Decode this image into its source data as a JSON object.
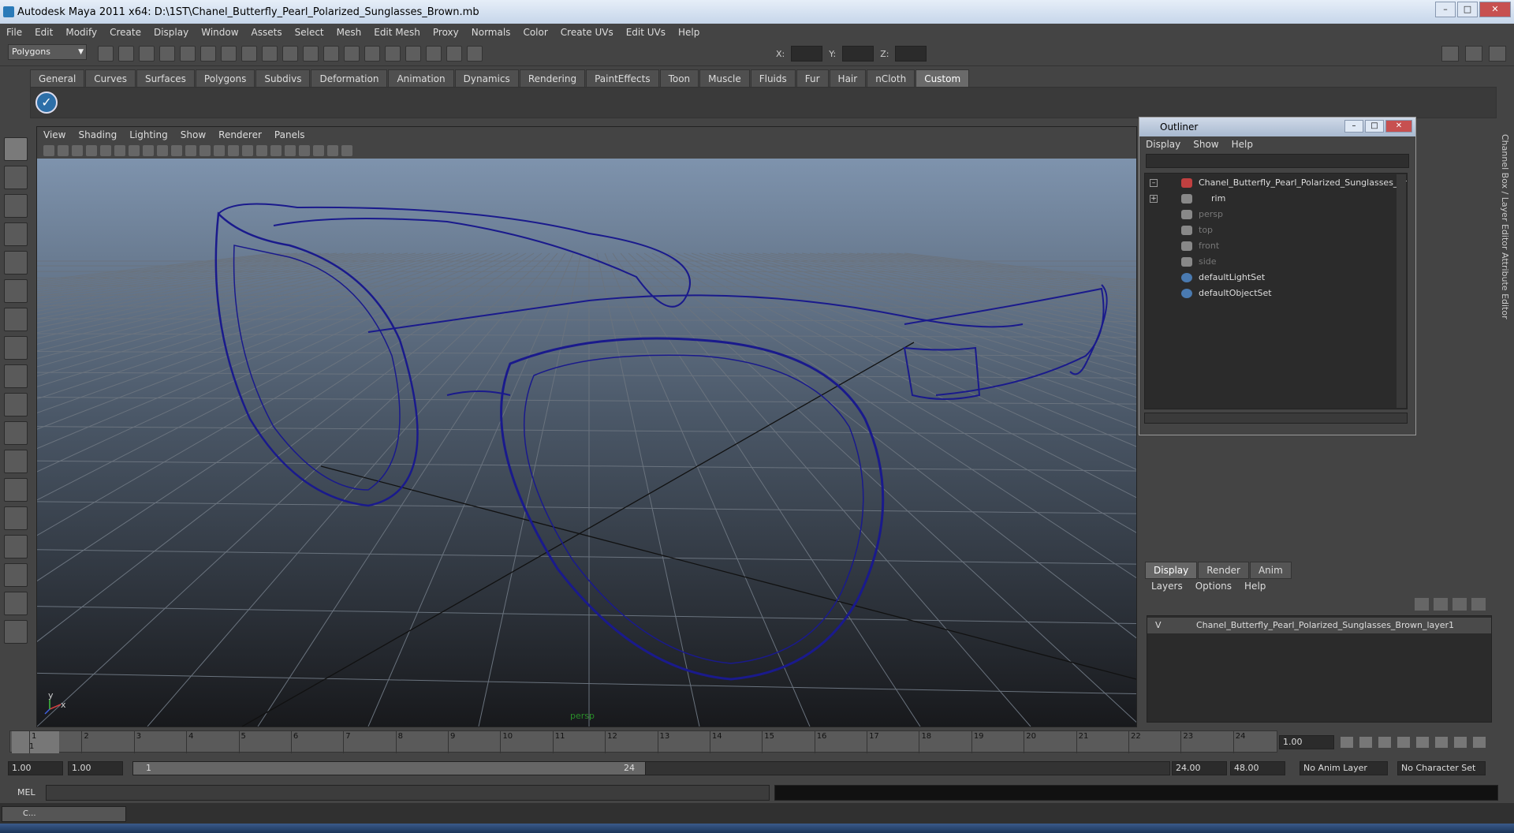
{
  "window": {
    "title": "Autodesk Maya 2011 x64: D:\\1ST\\Chanel_Butterfly_Pearl_Polarized_Sunglasses_Brown.mb"
  },
  "menus": [
    "File",
    "Edit",
    "Modify",
    "Create",
    "Display",
    "Window",
    "Assets",
    "Select",
    "Mesh",
    "Edit Mesh",
    "Proxy",
    "Normals",
    "Color",
    "Create UVs",
    "Edit UVs",
    "Help"
  ],
  "toolbar": {
    "mode": "Polygons",
    "x_label": "X:",
    "y_label": "Y:",
    "z_label": "Z:"
  },
  "shelf_tabs": [
    "General",
    "Curves",
    "Surfaces",
    "Polygons",
    "Subdivs",
    "Deformation",
    "Animation",
    "Dynamics",
    "Rendering",
    "PaintEffects",
    "Toon",
    "Muscle",
    "Fluids",
    "Fur",
    "Hair",
    "nCloth",
    "Custom"
  ],
  "viewport": {
    "menus": [
      "View",
      "Shading",
      "Lighting",
      "Show",
      "Renderer",
      "Panels"
    ],
    "camera_label": "persp",
    "axis_x": "x",
    "axis_y": "y",
    "wire_color": "#1a1a8c"
  },
  "outliner": {
    "title": "Outliner",
    "menus": [
      "Display",
      "Show",
      "Help"
    ],
    "items": [
      {
        "label": "Chanel_Butterfly_Pearl_Polarized_Sunglasses_Brown",
        "dim": false
      },
      {
        "label": "rim",
        "dim": false
      },
      {
        "label": "persp",
        "dim": true
      },
      {
        "label": "top",
        "dim": true
      },
      {
        "label": "front",
        "dim": true
      },
      {
        "label": "side",
        "dim": true
      },
      {
        "label": "defaultLightSet",
        "dim": false
      },
      {
        "label": "defaultObjectSet",
        "dim": false
      }
    ]
  },
  "side_tabs": {
    "channel_box": "Channel Box / Layer Editor",
    "attribute_editor": "Attribute Editor"
  },
  "layer_editor": {
    "tabs": [
      "Display",
      "Render",
      "Anim"
    ],
    "menus": [
      "Layers",
      "Options",
      "Help"
    ],
    "layer_visible": "V",
    "layer_name": "Chanel_Butterfly_Pearl_Polarized_Sunglasses_Brown_layer1"
  },
  "timeline": {
    "frames": [
      "1",
      "2",
      "3",
      "4",
      "5",
      "6",
      "7",
      "8",
      "9",
      "10",
      "11",
      "12",
      "13",
      "14",
      "15",
      "16",
      "17",
      "18",
      "19",
      "20",
      "21",
      "22",
      "23",
      "24"
    ],
    "current_frame_marker": "1",
    "current_frame": "1.00"
  },
  "range": {
    "start": "1.00",
    "playback_start": "1.00",
    "slider_start": "1",
    "slider_end": "24",
    "playback_end": "24.00",
    "end": "48.00",
    "anim_layer": "No Anim Layer",
    "character_set": "No Character Set"
  },
  "command_line": {
    "label": "MEL"
  },
  "taskbar": {
    "mini_window": "C..."
  }
}
